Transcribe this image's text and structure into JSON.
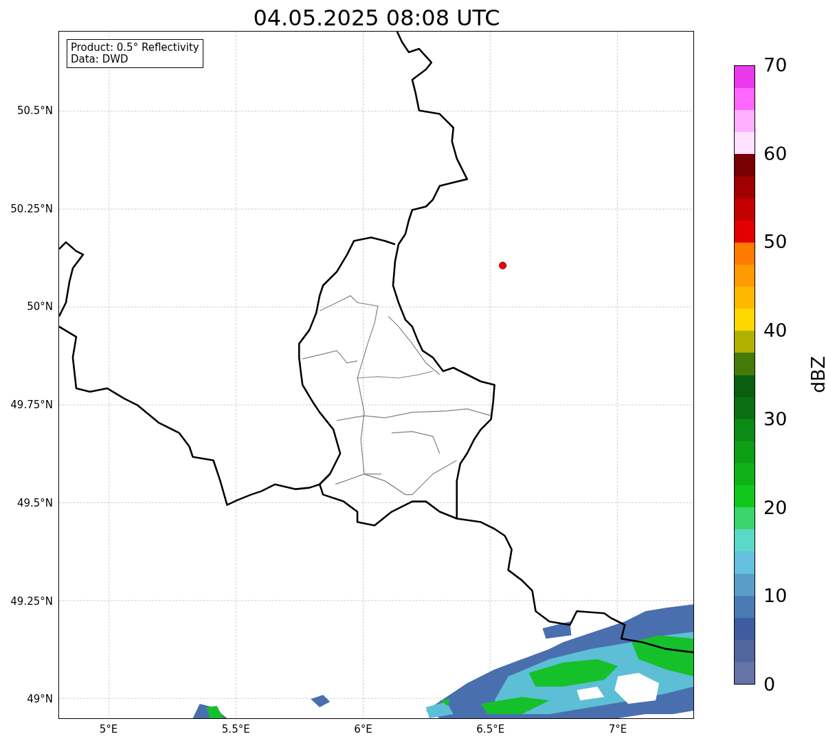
{
  "title": "04.05.2025 08:08 UTC",
  "info_box": {
    "lines": [
      "Product: 0.5° Reflectivity",
      "Data: DWD"
    ]
  },
  "map": {
    "y_tick_labels": [
      "50.5°N",
      "50.25°N",
      "50°N",
      "49.75°N",
      "49.5°N",
      "49.25°N",
      "49°N"
    ],
    "x_tick_labels": [
      "5°E",
      "5.5°E",
      "6°E",
      "6.5°E",
      "7°E"
    ]
  },
  "colorbar": {
    "label": "dBZ",
    "ticks": [
      "70",
      "60",
      "50",
      "40",
      "30",
      "20",
      "10",
      "0"
    ],
    "bands": [
      {
        "color": "#ec38ec"
      },
      {
        "color": "#ff66ff"
      },
      {
        "color": "#ffb0ff"
      },
      {
        "color": "#ffe0ff"
      },
      {
        "color": "#780000"
      },
      {
        "color": "#a00000"
      },
      {
        "color": "#c40000"
      },
      {
        "color": "#e40000"
      },
      {
        "color": "#ff7a00"
      },
      {
        "color": "#ff9a00"
      },
      {
        "color": "#ffb800"
      },
      {
        "color": "#ffd800"
      },
      {
        "color": "#b0b000"
      },
      {
        "color": "#447a0a"
      },
      {
        "color": "#08600e"
      },
      {
        "color": "#0a7012"
      },
      {
        "color": "#0c8a16"
      },
      {
        "color": "#0e9e14"
      },
      {
        "color": "#10b21a"
      },
      {
        "color": "#10c81c"
      },
      {
        "color": "#3cd46c"
      },
      {
        "color": "#5cd8c8"
      },
      {
        "color": "#64c0dc"
      },
      {
        "color": "#5a9ec8"
      },
      {
        "color": "#4a7ab4"
      },
      {
        "color": "#405ca0"
      },
      {
        "color": "#52669e"
      },
      {
        "color": "#6673a6"
      }
    ]
  }
}
